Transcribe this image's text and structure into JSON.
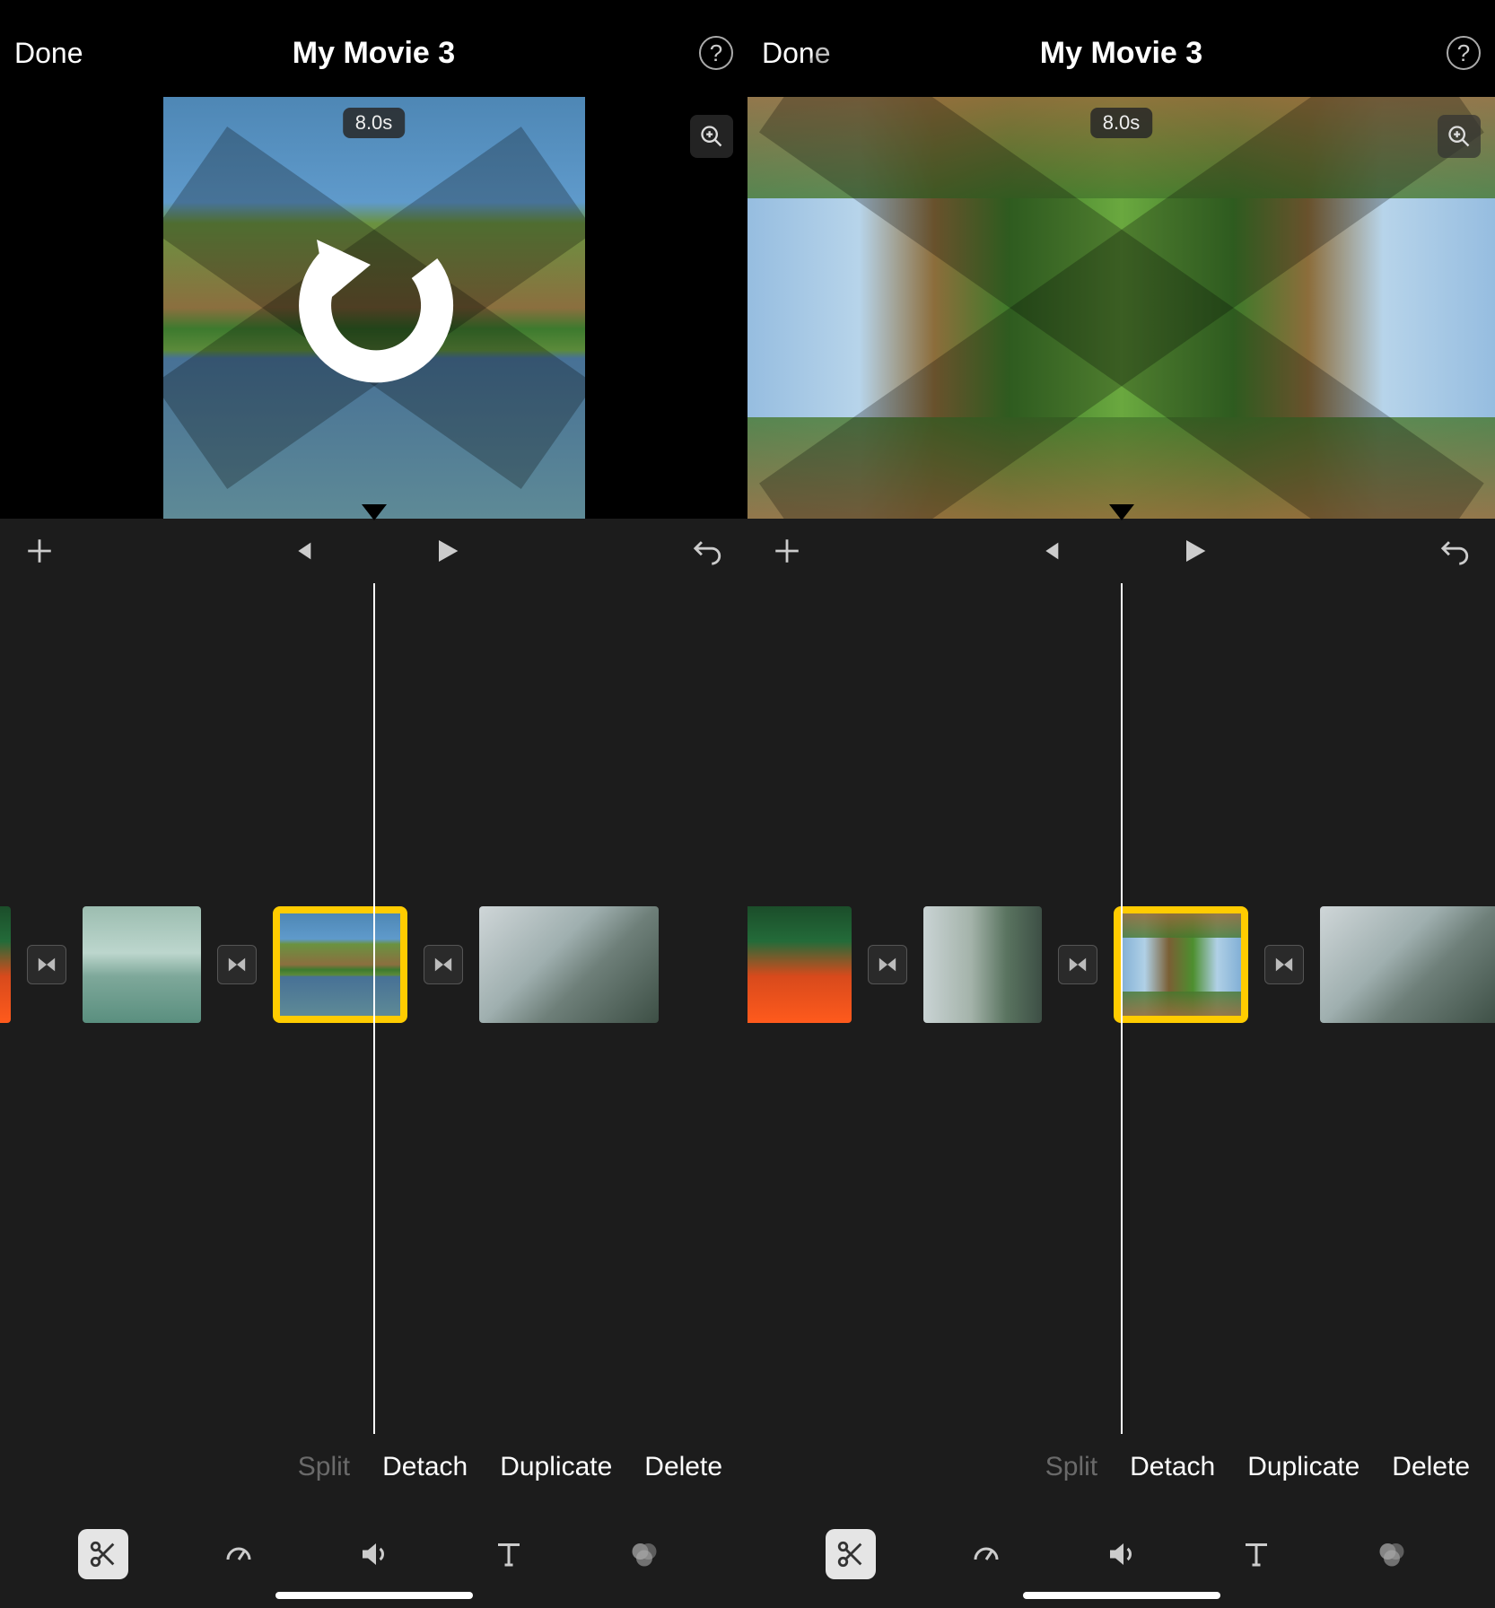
{
  "left": {
    "header": {
      "done": "Done",
      "title": "My Movie 3"
    },
    "preview": {
      "duration": "8.0s"
    },
    "actions": {
      "split": "Split",
      "detach": "Detach",
      "duplicate": "Duplicate",
      "delete": "Delete"
    }
  },
  "right": {
    "header": {
      "done": "Done",
      "title": "My Movie 3"
    },
    "preview": {
      "duration": "8.0s"
    },
    "actions": {
      "split": "Split",
      "detach": "Detach",
      "duplicate": "Duplicate",
      "delete": "Delete"
    }
  }
}
